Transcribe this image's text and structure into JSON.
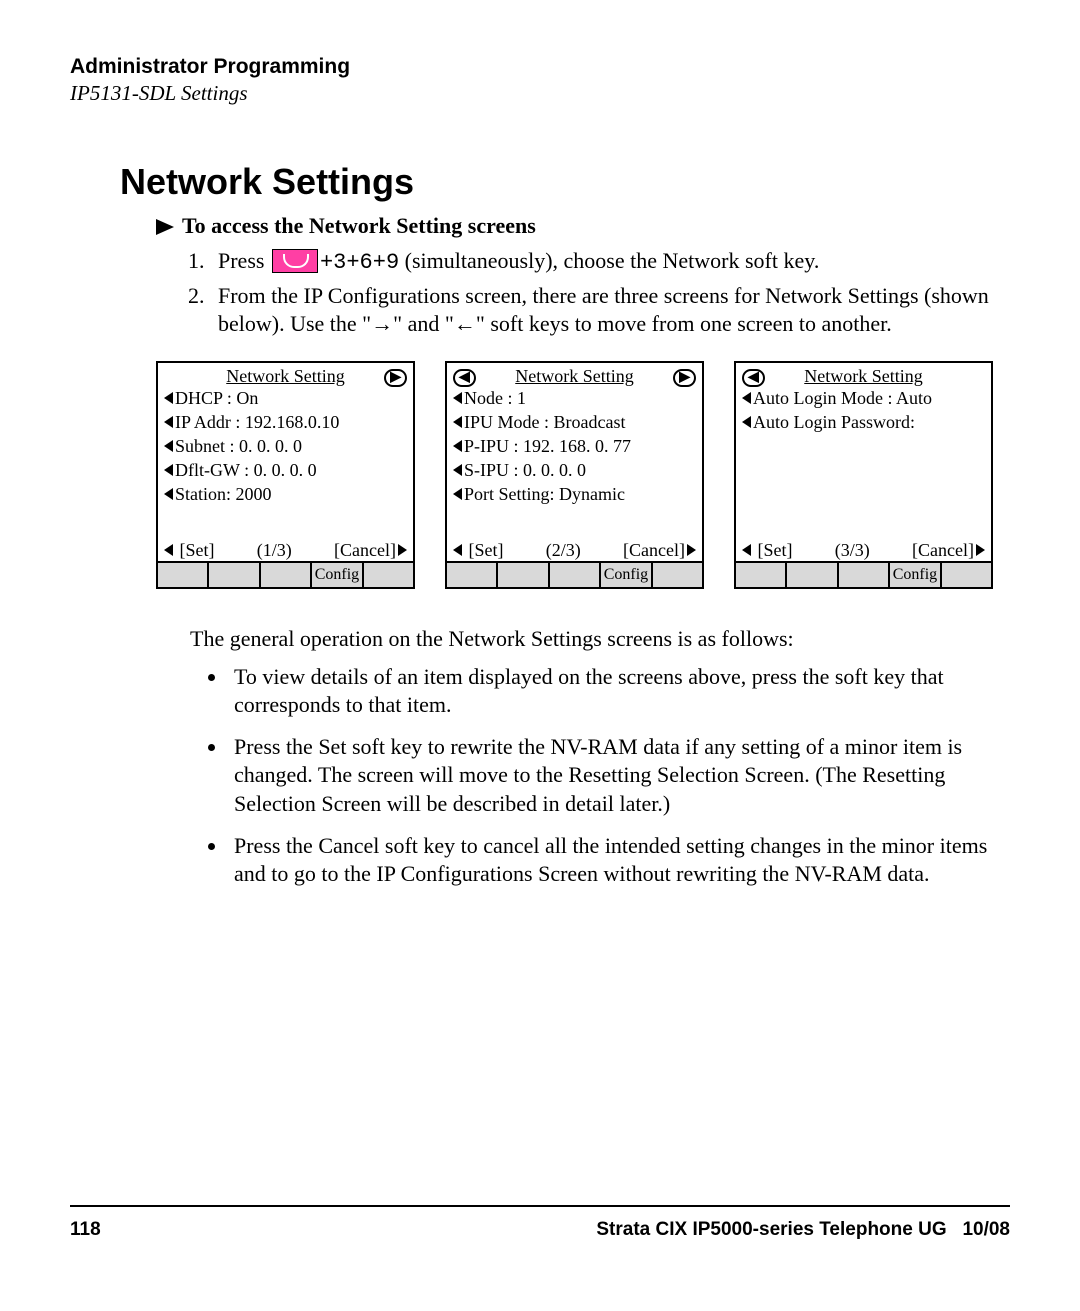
{
  "header": {
    "section": "Administrator Programming",
    "subsection": "IP5131-SDL Settings"
  },
  "title": "Network Settings",
  "subhead": "To access the Network Setting screens",
  "steps": {
    "s1_a": "Press ",
    "s1_keys": "+3+6+9",
    "s1_b": " (simultaneously), choose the Network soft key.",
    "s2": "From the IP Configurations screen, there are three screens for Network Settings (shown below). Use the \"→\" and \"←\" soft keys to move from one screen to another."
  },
  "screens": [
    {
      "title": "Network Setting",
      "left_arrow": false,
      "right_arrow": true,
      "lines": [
        "DHCP : On",
        "IP Addr : 192.168.0.10",
        "Subnet   : 0. 0. 0. 0",
        "Dflt-GW : 0. 0. 0. 0",
        "Station: 2000"
      ],
      "foot": {
        "set": "[Set]",
        "page": "(1/3)",
        "cancel": "[Cancel]"
      },
      "bar": [
        "",
        "",
        "",
        "Config",
        ""
      ]
    },
    {
      "title": "Network Setting",
      "left_arrow": true,
      "right_arrow": true,
      "lines": [
        "Node : 1",
        "IPU Mode : Broadcast",
        "P-IPU   : 192. 168. 0. 77",
        "S-IPU : 0. 0. 0. 0",
        "Port Setting: Dynamic"
      ],
      "foot": {
        "set": "[Set]",
        "page": "(2/3)",
        "cancel": "[Cancel]"
      },
      "bar": [
        "",
        "",
        "",
        "Config",
        ""
      ]
    },
    {
      "title": "Network Setting",
      "left_arrow": true,
      "right_arrow": false,
      "lines": [
        "Auto Login Mode : Auto",
        "Auto Login Password:"
      ],
      "foot": {
        "set": "[Set]",
        "page": "(3/3)",
        "cancel": "[Cancel]"
      },
      "bar": [
        "",
        "",
        "",
        "Config",
        ""
      ]
    }
  ],
  "body": {
    "intro": "The general operation on the Network Settings screens is as follows:",
    "bullets": [
      "To view details of an item displayed on the screens above, press the soft key that corresponds to that item.",
      "Press the Set soft key to rewrite the NV-RAM data if any setting of a minor item is changed. The screen will move to the Resetting Selection Screen. (The Resetting Selection Screen will be described in detail later.)",
      "Press the Cancel soft key to cancel all the intended setting changes in the minor items and to go to the IP Configurations Screen without rewriting the NV-RAM data."
    ]
  },
  "footer": {
    "page": "118",
    "doc": "Strata CIX IP5000-series Telephone UG",
    "date": "10/08"
  }
}
